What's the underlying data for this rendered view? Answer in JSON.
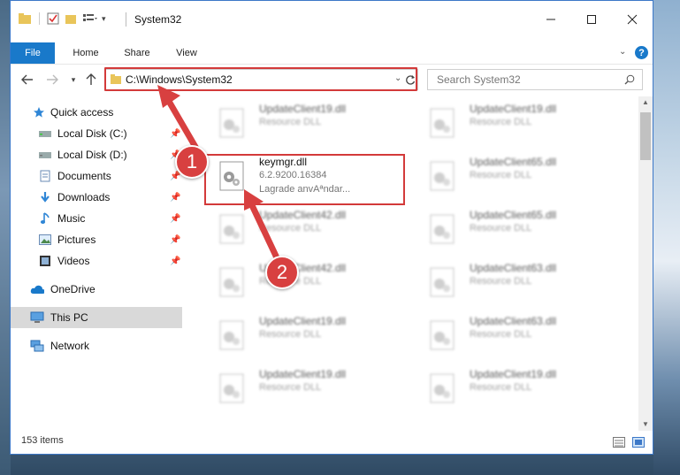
{
  "window": {
    "title": "System32"
  },
  "ribbon": {
    "tabs": [
      "File",
      "Home",
      "Share",
      "View"
    ]
  },
  "address": {
    "path": "C:\\Windows\\System32"
  },
  "search": {
    "placeholder": "Search System32"
  },
  "sidebar": {
    "items": [
      {
        "label": "Quick access",
        "icon": "star-icon"
      },
      {
        "label": "Local Disk (C:)",
        "icon": "drive-icon"
      },
      {
        "label": "Local Disk (D:)",
        "icon": "drive-icon"
      },
      {
        "label": "Documents",
        "icon": "documents-icon"
      },
      {
        "label": "Downloads",
        "icon": "downloads-icon"
      },
      {
        "label": "Music",
        "icon": "music-icon"
      },
      {
        "label": "Pictures",
        "icon": "pictures-icon"
      },
      {
        "label": "Videos",
        "icon": "videos-icon"
      },
      {
        "label": "OneDrive",
        "icon": "cloud-icon"
      },
      {
        "label": "This PC",
        "icon": "computer-icon"
      },
      {
        "label": "Network",
        "icon": "network-icon"
      }
    ]
  },
  "files": {
    "left": [
      {
        "name": "UpdateClient19.dll",
        "type": "Resource DLL"
      },
      {
        "name": "keymgr.dll",
        "version": "6.2.9200.16384",
        "desc": "Lagrade anvAªndar..."
      },
      {
        "name": "UpdateClient42.dll",
        "type": "Resource DLL"
      },
      {
        "name": "UpdateClient42.dll",
        "type": "Resource DLL"
      },
      {
        "name": "UpdateClient19.dll",
        "type": "Resource DLL"
      },
      {
        "name": "UpdateClient19.dll",
        "type": "Resource DLL"
      }
    ],
    "right": [
      {
        "name": "UpdateClient19.dll",
        "type": "Resource DLL"
      },
      {
        "name": "UpdateClient65.dll",
        "type": "Resource DLL"
      },
      {
        "name": "UpdateClient65.dll",
        "type": "Resource DLL"
      },
      {
        "name": "UpdateClient63.dll",
        "type": "Resource DLL"
      },
      {
        "name": "UpdateClient63.dll",
        "type": "Resource DLL"
      },
      {
        "name": "UpdateClient19.dll",
        "type": "Resource DLL"
      }
    ]
  },
  "status": {
    "count": "153 items"
  },
  "callouts": {
    "one": "1",
    "two": "2"
  },
  "colors": {
    "accent": "#1979ca",
    "highlight": "#d33a3a"
  }
}
